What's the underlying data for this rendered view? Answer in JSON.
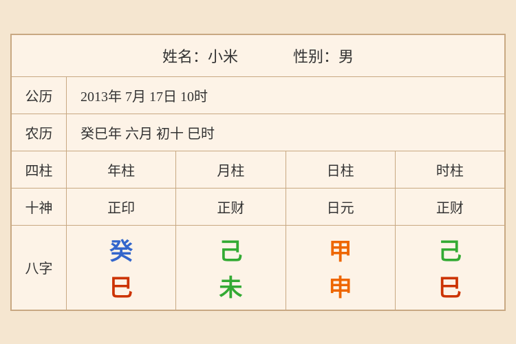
{
  "header": {
    "name_label": "姓名：小米",
    "gender_label": "性别：男"
  },
  "gregorian": {
    "label": "公历",
    "value": "2013年 7月 17日 10时"
  },
  "lunar": {
    "label": "农历",
    "value": "癸巳年 六月 初十 巳时"
  },
  "columns": {
    "label": "四柱",
    "year": "年柱",
    "month": "月柱",
    "day": "日柱",
    "hour": "时柱"
  },
  "shishen": {
    "label": "十神",
    "year": "正印",
    "month": "正财",
    "day": "日元",
    "hour": "正财"
  },
  "bazhi": {
    "label": "八字",
    "year_top": "癸",
    "year_bottom": "巳",
    "month_top": "己",
    "month_bottom": "未",
    "day_top": "甲",
    "day_bottom": "申",
    "hour_top": "己",
    "hour_bottom": "巳"
  }
}
